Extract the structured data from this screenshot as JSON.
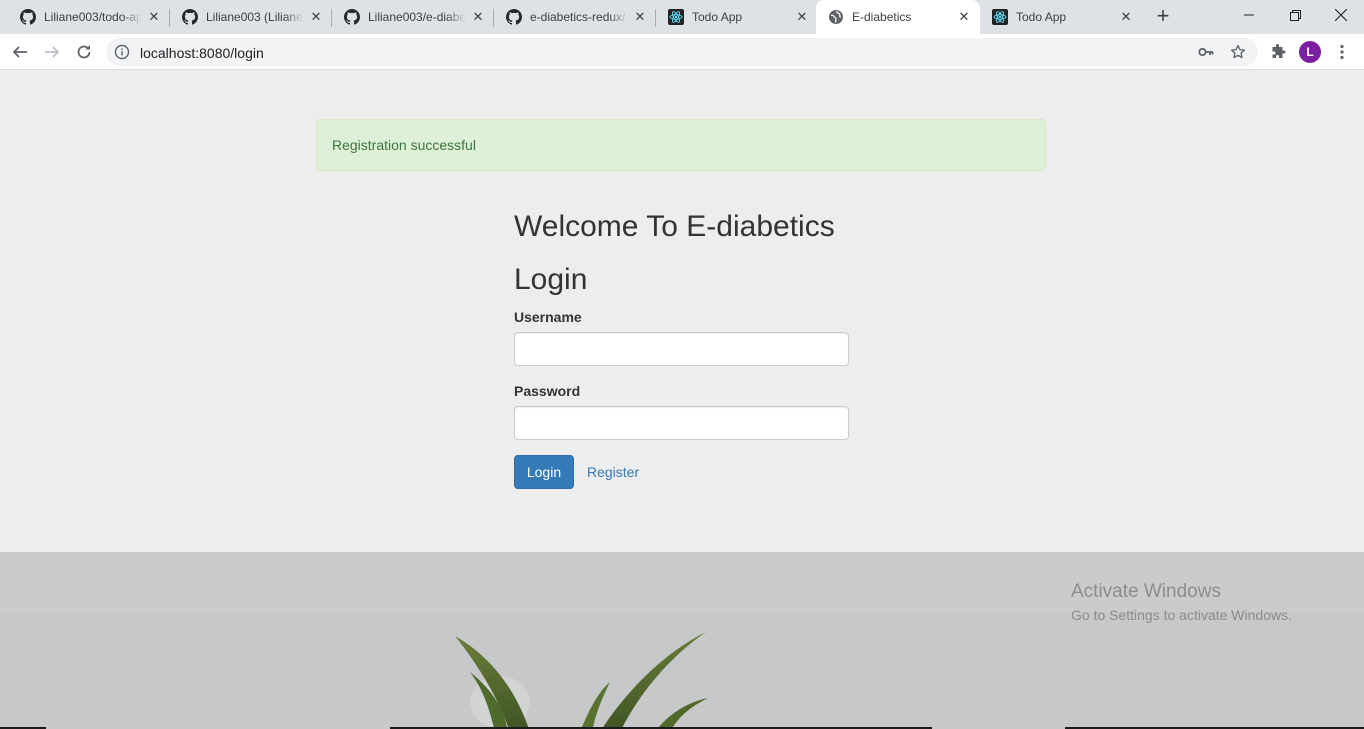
{
  "browser": {
    "tabs": [
      {
        "title": "Liliane003/todo-ap",
        "icon": "github-icon"
      },
      {
        "title": "Liliane003 (Liliane",
        "icon": "github-icon"
      },
      {
        "title": "Liliane003/e-diabe",
        "icon": "github-icon"
      },
      {
        "title": "e-diabetics-redux/",
        "icon": "github-icon"
      },
      {
        "title": "Todo App",
        "icon": "react-icon"
      },
      {
        "title": "E-diabetics",
        "icon": "globe-icon",
        "active": true
      },
      {
        "title": "Todo App",
        "icon": "react-icon"
      }
    ],
    "url": "localhost:8080/login",
    "profile_initial": "L",
    "profile_color": "#7b1fa2"
  },
  "alert": {
    "message": "Registration successful"
  },
  "login": {
    "welcome": "Welcome To E-diabetics",
    "heading": "Login",
    "username_label": "Username",
    "username_value": "",
    "password_label": "Password",
    "password_value": "",
    "login_button": "Login",
    "register_link": "Register"
  },
  "watermark": {
    "line1": "Activate Windows",
    "line2": "Go to Settings to activate Windows."
  },
  "colors": {
    "primary": "#337ab7",
    "alert_bg": "#dff0d8",
    "alert_text": "#3c763d",
    "page_bg": "#ededed"
  }
}
